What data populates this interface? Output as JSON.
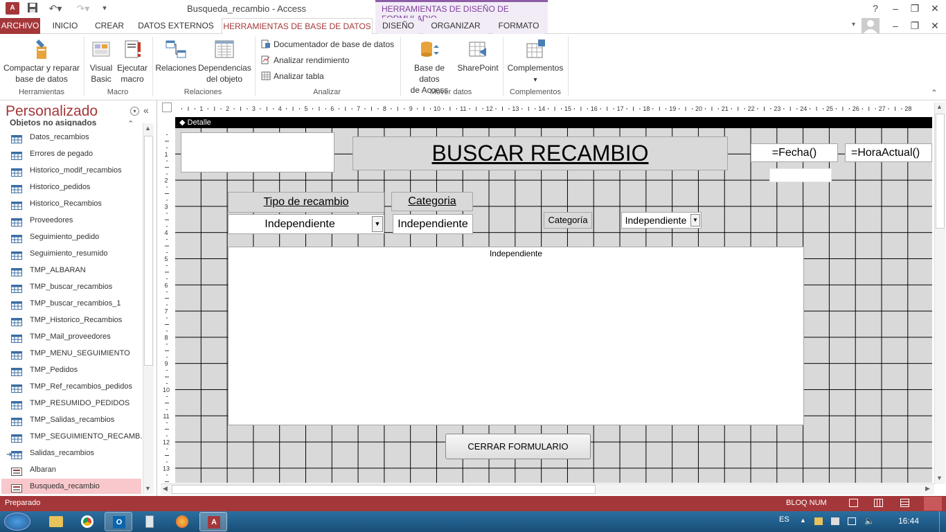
{
  "window": {
    "title": "Busqueda_recambio - Access",
    "context_tools": "HERRAMIENTAS DE DISEÑO DE FORMULARIO",
    "help": "?"
  },
  "tabs": [
    "ARCHIVO",
    "INICIO",
    "CREAR",
    "DATOS EXTERNOS",
    "HERRAMIENTAS DE BASE DE DATOS",
    "DISEÑO",
    "ORGANIZAR",
    "FORMATO"
  ],
  "ribbon": {
    "herramientas": {
      "compactar_1": "Compactar y reparar",
      "compactar_2": "base de datos",
      "group": "Herramientas"
    },
    "macro": {
      "visual_1": "Visual",
      "visual_2": "Basic",
      "ejecutar_1": "Ejecutar",
      "ejecutar_2": "macro",
      "group": "Macro"
    },
    "relaciones": {
      "relaciones": "Relaciones",
      "dependencias_1": "Dependencias",
      "dependencias_2": "del objeto",
      "group": "Relaciones"
    },
    "analizar": {
      "documentador": "Documentador de base de datos",
      "rendimiento": "Analizar rendimiento",
      "tabla": "Analizar tabla",
      "group": "Analizar"
    },
    "mover": {
      "bd_1": "Base de datos",
      "bd_2": "de Access",
      "sharepoint": "SharePoint",
      "group": "Mover datos"
    },
    "complementos": {
      "label": "Complementos",
      "arrow": "▾",
      "group": "Complementos"
    }
  },
  "nav": {
    "title": "Personalizado",
    "group": "Objetos no asignados",
    "items": [
      {
        "label": "Datos_recambios",
        "type": "table"
      },
      {
        "label": "Errores de pegado",
        "type": "table"
      },
      {
        "label": "Historico_modif_recambios",
        "type": "table"
      },
      {
        "label": "Historico_pedidos",
        "type": "table"
      },
      {
        "label": "Historico_Recambios",
        "type": "table"
      },
      {
        "label": "Proveedores",
        "type": "table"
      },
      {
        "label": "Seguimiento_pedido",
        "type": "table"
      },
      {
        "label": "Seguimiento_resumido",
        "type": "table"
      },
      {
        "label": "TMP_ALBARAN",
        "type": "table"
      },
      {
        "label": "TMP_buscar_recambios",
        "type": "table"
      },
      {
        "label": "TMP_buscar_recambios_1",
        "type": "table"
      },
      {
        "label": "TMP_Historico_Recambios",
        "type": "table"
      },
      {
        "label": "TMP_Mail_proveedores",
        "type": "table"
      },
      {
        "label": "TMP_MENU_SEGUIMIENTO",
        "type": "table"
      },
      {
        "label": "TMP_Pedidos",
        "type": "table"
      },
      {
        "label": "TMP_Ref_recambios_pedidos",
        "type": "table"
      },
      {
        "label": "TMP_RESUMIDO_PEDIDOS",
        "type": "table"
      },
      {
        "label": "TMP_Salidas_recambios",
        "type": "table"
      },
      {
        "label": "TMP_SEGUIMIENTO_RECAMB...",
        "type": "table"
      },
      {
        "label": "Salidas_recambios",
        "type": "linked-table"
      },
      {
        "label": "Albaran",
        "type": "form"
      },
      {
        "label": "Busqueda_recambio",
        "type": "form",
        "selected": true
      }
    ]
  },
  "design": {
    "section": "Detalle",
    "ruler_top": [
      "1",
      "2",
      "3",
      "4",
      "5",
      "6",
      "7",
      "8",
      "9",
      "10",
      "11",
      "12",
      "13",
      "14",
      "15",
      "16",
      "17",
      "18",
      "19",
      "20",
      "21",
      "22",
      "23",
      "24",
      "25",
      "26",
      "27",
      "28"
    ],
    "ruler_left": [
      "1",
      "2",
      "3",
      "4",
      "5",
      "6",
      "7",
      "8",
      "9",
      "10",
      "11",
      "12",
      "13"
    ],
    "title": "BUSCAR RECAMBIO",
    "fecha": "=Fecha()",
    "hora": "=HoraActual()",
    "tipo_label": "Tipo de recambio",
    "categoria_label": "Categoria",
    "tipo_combo": "Independiente",
    "categoria_text": "Independiente",
    "categoria_label2": "Categoría",
    "categoria_combo": "Independiente",
    "subform_label": "Independiente",
    "cerrar_button": "CERRAR FORMULARIO"
  },
  "status": {
    "left": "Preparado",
    "bloq": "BLOQ NUM"
  },
  "taskbar": {
    "lang": "ES",
    "time": "16:44"
  },
  "colors": {
    "accent": "#a4373a",
    "context": "#7d3c98",
    "grid": "#d9d9d9",
    "selected": "#f8c8cc"
  }
}
